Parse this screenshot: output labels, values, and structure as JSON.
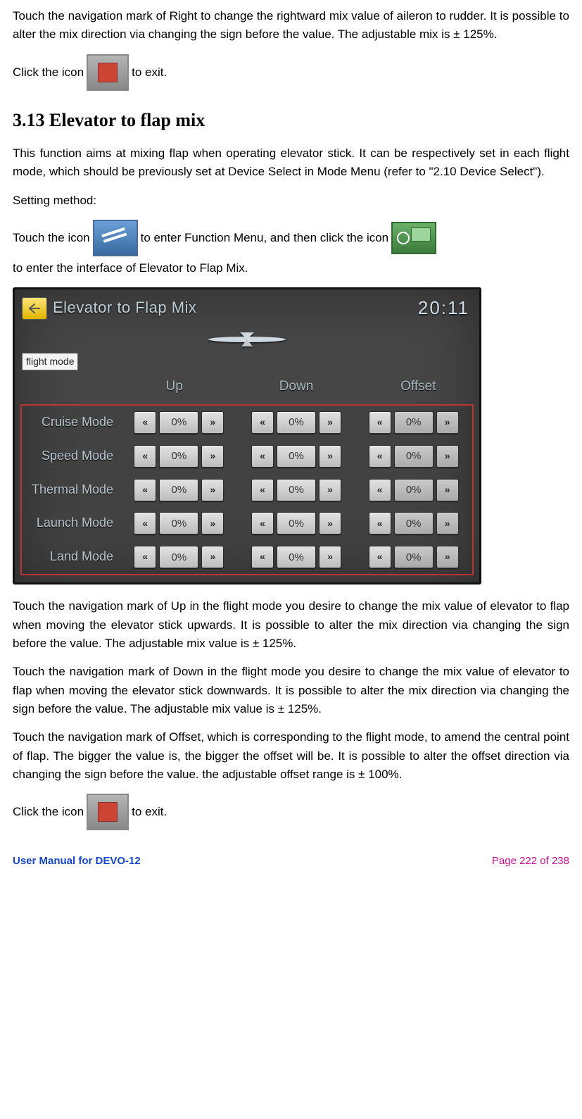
{
  "intro": {
    "p1": "Touch the navigation mark of Right to change the rightward mix value of aileron to rudder. It is possible to alter the mix direction via changing the sign before the value. The adjustable mix is  ± 125%.",
    "exit_pre": "Click the icon",
    "exit_post": " to exit."
  },
  "heading": "3.13 Elevator to flap mix",
  "body": {
    "p1": "This function aims at mixing flap when operating elevator stick. It can be respectively set in each flight mode, which should be previously set at Device Select in Mode Menu (refer to \"2.10 Device Select\").",
    "setting": "Setting method:",
    "touch_pre": "Touch the icon",
    "touch_mid": " to enter Function Menu, and then click the icon",
    "touch_post": " to enter the interface of Elevator to Flap Mix.",
    "p_up": "Touch the navigation mark of Up in the flight mode you desire to change the mix value of elevator to flap when moving the elevator stick upwards. It is possible to alter the mix direction via changing the sign before the value. The adjustable mix value is ± 125%.",
    "p_down": "Touch the navigation mark of Down in the flight mode you desire to change the mix value of elevator to flap when moving the elevator stick downwards. It is possible to alter the mix direction via changing the sign before the value. The adjustable mix value is ± 125%.",
    "p_offset": "Touch the navigation mark of Offset, which is corresponding to the flight mode, to amend the central point of flap. The bigger the value is, the bigger the offset will be. It is possible to alter the offset direction via changing the sign before the value. the adjustable offset range is   ± 100%.",
    "exit_pre2": "Click the icon",
    "exit_post2": " to exit."
  },
  "shot": {
    "title": "Elevator to Flap Mix",
    "clock": "20:11",
    "fm_label": "flight mode",
    "headers": [
      "",
      "Up",
      "Down",
      "Offset"
    ],
    "modes": [
      "Cruise Mode",
      "Speed Mode",
      "Thermal Mode",
      "Launch Mode",
      "Land Mode"
    ],
    "value": "0%",
    "chev_l": "«",
    "chev_r": "»"
  },
  "footer": {
    "left": "User Manual for DEVO-12",
    "right": "Page 222 of 238"
  }
}
